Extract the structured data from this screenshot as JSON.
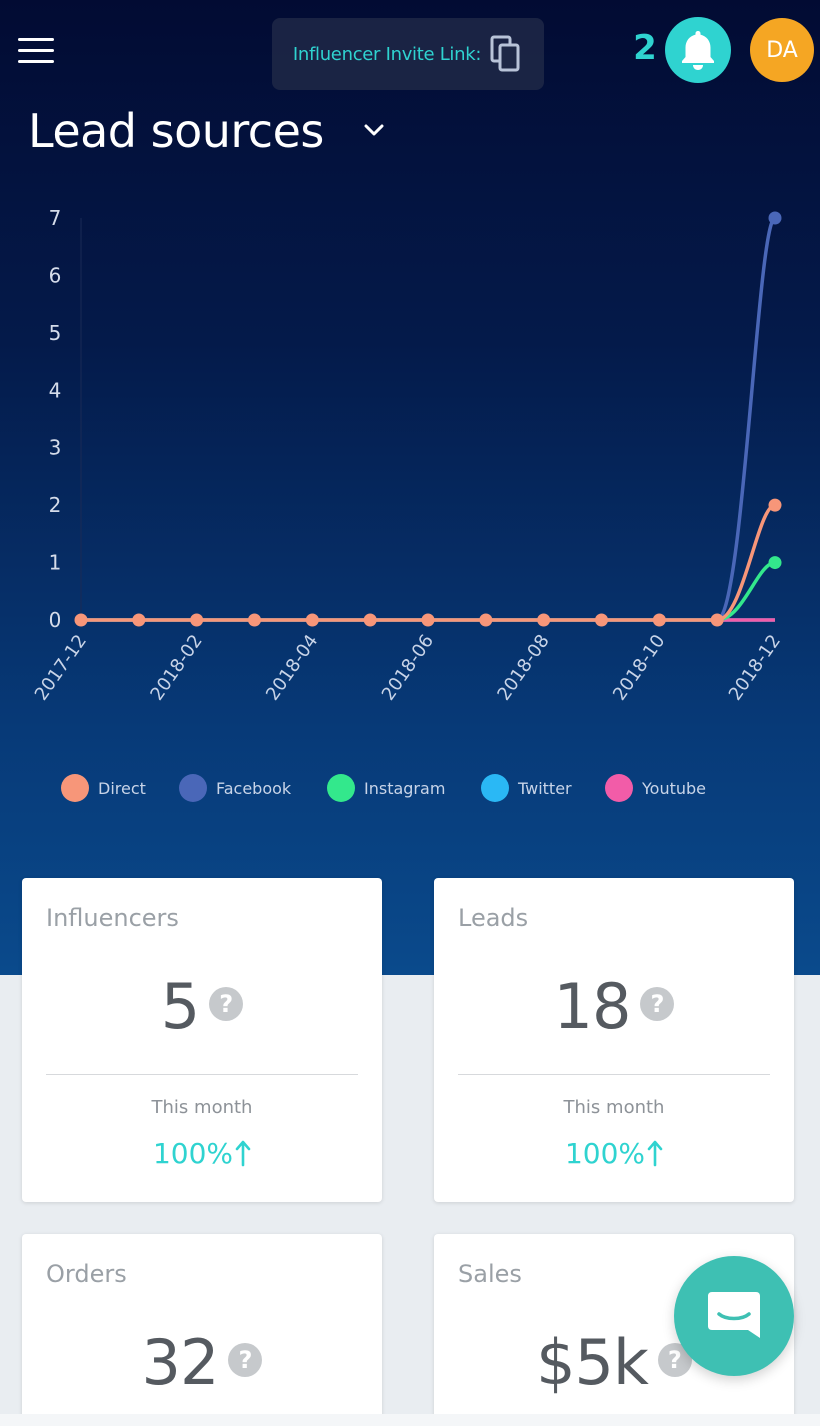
{
  "header": {
    "invite_label": "Influencer Invite Link:",
    "notification_count": "2",
    "avatar_initials": "DA"
  },
  "page": {
    "title": "Lead sources"
  },
  "colors": {
    "accent": "#2fd3d0",
    "avatar": "#f5a623",
    "chat": "#3ec0b3"
  },
  "icons": [
    "menu-icon",
    "copy-icon",
    "bell-icon",
    "chevron-down-icon",
    "help-icon",
    "arrow-up-icon",
    "chat-icon"
  ],
  "chart_data": {
    "type": "line",
    "x": [
      "2017-12",
      "2018-01",
      "2018-02",
      "2018-03",
      "2018-04",
      "2018-05",
      "2018-06",
      "2018-07",
      "2018-08",
      "2018-09",
      "2018-10",
      "2018-11",
      "2018-12"
    ],
    "tick_labels": [
      "2017-12",
      "2018-02",
      "2018-04",
      "2018-06",
      "2018-08",
      "2018-10",
      "2018-12"
    ],
    "y_ticks": [
      0,
      1,
      2,
      3,
      4,
      5,
      6,
      7
    ],
    "ylim": [
      0,
      7
    ],
    "series": [
      {
        "name": "Direct",
        "color": "#f79679",
        "values": [
          0,
          0,
          0,
          0,
          0,
          0,
          0,
          0,
          0,
          0,
          0,
          0,
          2
        ]
      },
      {
        "name": "Facebook",
        "color": "#4a67b8",
        "values": [
          0,
          0,
          0,
          0,
          0,
          0,
          0,
          0,
          0,
          0,
          0,
          0,
          7
        ]
      },
      {
        "name": "Instagram",
        "color": "#33e88c",
        "values": [
          0,
          0,
          0,
          0,
          0,
          0,
          0,
          0,
          0,
          0,
          0,
          0,
          1
        ]
      },
      {
        "name": "Twitter",
        "color": "#2ab8f5",
        "values": [
          0,
          0,
          0,
          0,
          0,
          0,
          0,
          0,
          0,
          0,
          0,
          0,
          0
        ]
      },
      {
        "name": "Youtube",
        "color": "#f25ca8",
        "values": [
          0,
          0,
          0,
          0,
          0,
          0,
          0,
          0,
          0,
          0,
          0,
          0,
          0
        ]
      }
    ],
    "legend_position": "bottom",
    "grid": false
  },
  "cards": [
    {
      "title": "Influencers",
      "value": "5",
      "sub": "This month",
      "delta": "100%"
    },
    {
      "title": "Leads",
      "value": "18",
      "sub": "This month",
      "delta": "100%"
    },
    {
      "title": "Orders",
      "value": "32"
    },
    {
      "title": "Sales",
      "value": "$5k"
    }
  ]
}
